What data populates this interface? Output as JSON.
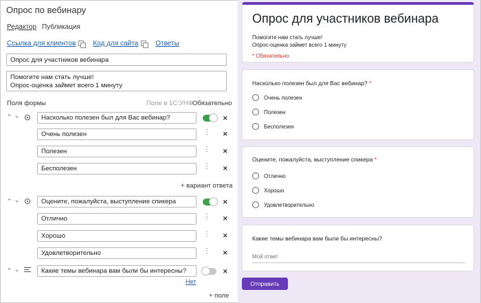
{
  "editor": {
    "title": "Опрос по вебинару",
    "modes": [
      "Редактор",
      "Публикация"
    ],
    "links": [
      "Ссылка для клиентов",
      "Код для сайта",
      "Ответы"
    ],
    "form_title": "Опрос для участников вебинара",
    "description_lines": [
      "Помогите нам стать лучше!",
      "Опрос-оценка займет всего 1 минуту"
    ],
    "fields_label": "Поля формы",
    "field_1c_label": "Поле в 1С:УНФ",
    "required_label": "Обязательно",
    "questions": [
      {
        "text": "Насколько полезен был для Вас вебинар?",
        "type": "radio",
        "required": true,
        "options": [
          "Очень полезен",
          "Полезен",
          "Бесполезен"
        ],
        "add_option": "+ вариант ответа"
      },
      {
        "text": "Оцените, пожалуйста, выступление спикера",
        "type": "radio",
        "required": true,
        "options": [
          "Отлично",
          "Хорошо",
          "Удовлетворительно"
        ]
      },
      {
        "text": "Какие темы вебинара вам были бы интересны?",
        "type": "text",
        "required": false,
        "none_link": "Нет"
      }
    ],
    "add_field": "+ поле"
  },
  "preview": {
    "title": "Опрос для участников вебинара",
    "description_lines": [
      "Помогите нам стать лучше!",
      "Опрос-оценка займет всего 1 минуту"
    ],
    "required_note": "* Обязательно",
    "q1": {
      "text": "Насколько полезен был для Вас вебинар?",
      "star": "*",
      "options": [
        "Очень полезен",
        "Полезен",
        "Бесполезен"
      ]
    },
    "q2": {
      "text": "Оцените, пожалуйста, выступление спикера",
      "star": "*",
      "options": [
        "Отлично",
        "Хорошо",
        "Удовлетворительно"
      ]
    },
    "q3": {
      "text": "Какие темы вебинара вам были бы интересны?",
      "answer_placeholder": "Мой ответ"
    },
    "submit_label": "Отправить"
  },
  "colors": {
    "accent": "#673ab7",
    "preview_bg": "#ede7f6",
    "toggle_on": "#3aa04a",
    "link": "#1a5fb4",
    "required": "#d93025"
  },
  "icons": [
    "copy-icon",
    "arrow-up-icon",
    "arrow-down-icon",
    "radio-type-icon",
    "text-type-icon",
    "more-vert-icon",
    "close-icon"
  ]
}
